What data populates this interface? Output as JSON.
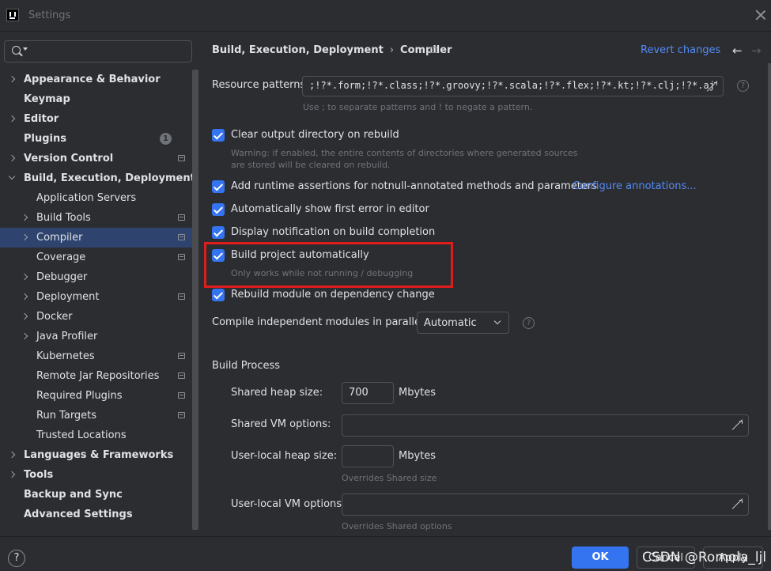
{
  "window": {
    "title": "Settings"
  },
  "search": {
    "placeholder": ""
  },
  "tree": [
    {
      "label": "Appearance & Behavior",
      "bold": true,
      "indent": 0,
      "chevron": "right",
      "pin": false,
      "badge": ""
    },
    {
      "label": "Keymap",
      "bold": true,
      "indent": 0,
      "chevron": "none",
      "pin": false,
      "badge": ""
    },
    {
      "label": "Editor",
      "bold": true,
      "indent": 0,
      "chevron": "right",
      "pin": false,
      "badge": ""
    },
    {
      "label": "Plugins",
      "bold": true,
      "indent": 0,
      "chevron": "none",
      "pin": false,
      "badge": "1"
    },
    {
      "label": "Version Control",
      "bold": true,
      "indent": 0,
      "chevron": "right",
      "pin": true,
      "badge": ""
    },
    {
      "label": "Build, Execution, Deployment",
      "bold": true,
      "indent": 0,
      "chevron": "down",
      "pin": false,
      "badge": ""
    },
    {
      "label": "Application Servers",
      "bold": false,
      "indent": 1,
      "chevron": "none",
      "pin": false,
      "badge": ""
    },
    {
      "label": "Build Tools",
      "bold": false,
      "indent": 1,
      "chevron": "right",
      "pin": true,
      "badge": ""
    },
    {
      "label": "Compiler",
      "bold": false,
      "indent": 1,
      "chevron": "right",
      "pin": true,
      "badge": "",
      "selected": true
    },
    {
      "label": "Coverage",
      "bold": false,
      "indent": 1,
      "chevron": "none",
      "pin": true,
      "badge": ""
    },
    {
      "label": "Debugger",
      "bold": false,
      "indent": 1,
      "chevron": "right",
      "pin": false,
      "badge": ""
    },
    {
      "label": "Deployment",
      "bold": false,
      "indent": 1,
      "chevron": "right",
      "pin": true,
      "badge": ""
    },
    {
      "label": "Docker",
      "bold": false,
      "indent": 1,
      "chevron": "right",
      "pin": false,
      "badge": ""
    },
    {
      "label": "Java Profiler",
      "bold": false,
      "indent": 1,
      "chevron": "right",
      "pin": false,
      "badge": ""
    },
    {
      "label": "Kubernetes",
      "bold": false,
      "indent": 1,
      "chevron": "none",
      "pin": true,
      "badge": ""
    },
    {
      "label": "Remote Jar Repositories",
      "bold": false,
      "indent": 1,
      "chevron": "none",
      "pin": true,
      "badge": ""
    },
    {
      "label": "Required Plugins",
      "bold": false,
      "indent": 1,
      "chevron": "none",
      "pin": true,
      "badge": ""
    },
    {
      "label": "Run Targets",
      "bold": false,
      "indent": 1,
      "chevron": "none",
      "pin": true,
      "badge": ""
    },
    {
      "label": "Trusted Locations",
      "bold": false,
      "indent": 1,
      "chevron": "none",
      "pin": false,
      "badge": ""
    },
    {
      "label": "Languages & Frameworks",
      "bold": true,
      "indent": 0,
      "chevron": "right",
      "pin": false,
      "badge": ""
    },
    {
      "label": "Tools",
      "bold": true,
      "indent": 0,
      "chevron": "right",
      "pin": false,
      "badge": ""
    },
    {
      "label": "Backup and Sync",
      "bold": true,
      "indent": 0,
      "chevron": "none",
      "pin": false,
      "badge": ""
    },
    {
      "label": "Advanced Settings",
      "bold": true,
      "indent": 0,
      "chevron": "none",
      "pin": false,
      "badge": ""
    }
  ],
  "header": {
    "crumb_parent": "Build, Execution, Deployment",
    "crumb_sep": "›",
    "crumb_current": "Compiler",
    "revert": "Revert changes",
    "back": "←",
    "forward": "→"
  },
  "resource": {
    "label": "Resource patterns:",
    "value": ";!?*.form;!?*.class;!?*.groovy;!?*.scala;!?*.flex;!?*.kt;!?*.clj;!?*.aj",
    "hint": "Use ; to separate patterns and ! to negate a pattern."
  },
  "options": {
    "clear_output": {
      "label": "Clear output directory on rebuild",
      "checked": true,
      "warning_1": "Warning: if enabled, the entire contents of directories where generated sources",
      "warning_2": "are stored will be cleared on rebuild."
    },
    "runtime_assertions": {
      "label": "Add runtime assertions for notnull-annotated methods and parameters",
      "checked": true,
      "link": "Configure annotations..."
    },
    "show_first_error": {
      "label": "Automatically show first error in editor",
      "checked": true
    },
    "notify_completion": {
      "label": "Display notification on build completion",
      "checked": true
    },
    "build_auto": {
      "label": "Build project automatically",
      "checked": true,
      "hint": "Only works while not running / debugging"
    },
    "rebuild_module": {
      "label": "Rebuild module on dependency change",
      "checked": true
    }
  },
  "parallel": {
    "label": "Compile independent modules in parallel:",
    "value": "Automatic"
  },
  "build_process": {
    "title": "Build Process",
    "shared_heap_label": "Shared heap size:",
    "shared_heap_value": "700",
    "shared_heap_unit": "Mbytes",
    "shared_vm_label": "Shared VM options:",
    "shared_vm_value": "",
    "user_heap_label": "User-local heap size:",
    "user_heap_value": "",
    "user_heap_unit": "Mbytes",
    "user_heap_hint": "Overrides Shared size",
    "user_vm_label": "User-local VM options:",
    "user_vm_value": "",
    "user_vm_hint": "Overrides Shared options"
  },
  "footer": {
    "help": "?",
    "ok": "OK",
    "cancel": "Cancel",
    "apply": "Apply",
    "watermark": "CSDN @Romola_ljl"
  },
  "colors": {
    "accent": "#3574f0",
    "link": "#548af7",
    "highlight_box": "#e01c1c",
    "selection": "#2e436e"
  }
}
